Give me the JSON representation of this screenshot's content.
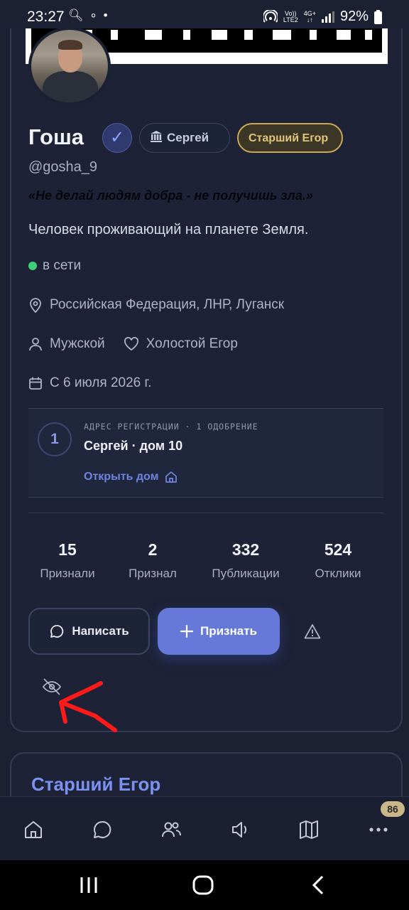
{
  "statusbar": {
    "time": "23:27",
    "left_icons": "🔍︎ ∘ •",
    "vo_label": "Vo))",
    "lte_label": "LTE2",
    "net_label": "4G+",
    "battery": "92%"
  },
  "profile": {
    "name": "Гоша",
    "verified_icon": "✓",
    "city_pill": "Сергей",
    "rank_pill": "Старший Егор",
    "handle": "@gosha_9",
    "quote": "«Не делай людям добра - не получишь зла.»",
    "bio": "Человек проживающий на планете Земля.",
    "status": "в сети",
    "location": "Российская Федерация, ЛНР, Луганск",
    "gender": "Мужской",
    "relationship": "Холостой Егор",
    "since": "С 6 июля 2026 г."
  },
  "registration": {
    "count": "1",
    "caption": "АДРЕС РЕГИСТРАЦИИ · 1 ОДОБРЕНИЕ",
    "address": "Сергей · дом 10",
    "open_label": "Открыть дом"
  },
  "stats": [
    {
      "value": "15",
      "label": "Признали"
    },
    {
      "value": "2",
      "label": "Признал"
    },
    {
      "value": "332",
      "label": "Публикации"
    },
    {
      "value": "524",
      "label": "Отклики"
    }
  ],
  "actions": {
    "write_label": "Написать",
    "ack_label": "Признать"
  },
  "section2": {
    "title": "Старший Егор"
  },
  "navbar": {
    "more_badge": "86"
  },
  "colors": {
    "background": "#1b2033",
    "accent": "#6678d8",
    "gold": "#c9a857",
    "online": "#3ecf7a",
    "annotation": "#ff1a1a"
  }
}
